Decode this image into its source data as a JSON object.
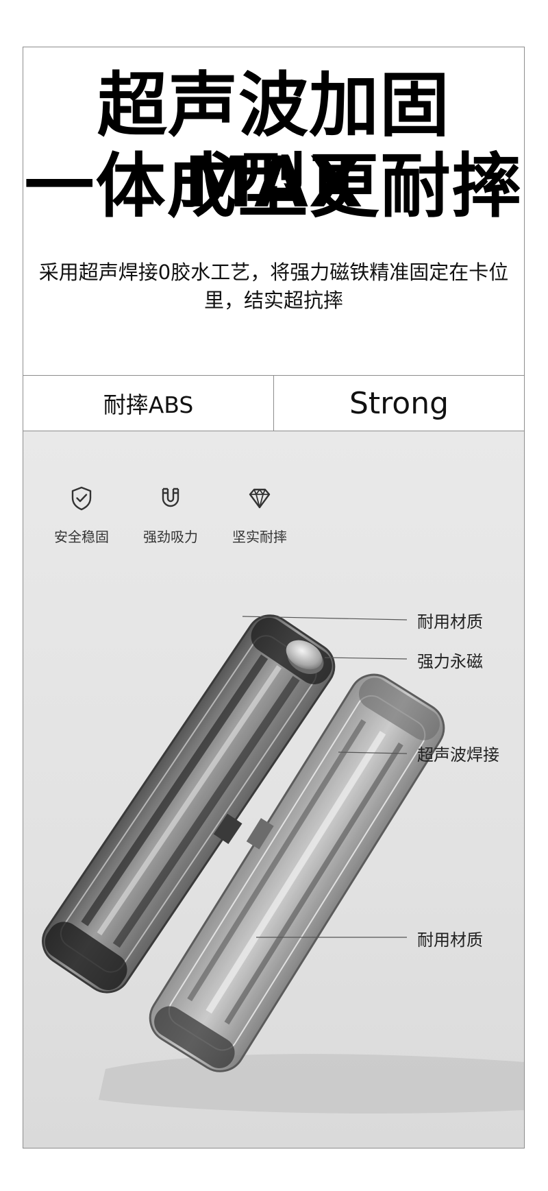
{
  "headline": {
    "line1": "超声波加固MAX",
    "line2": "一体成型更耐摔"
  },
  "description": "采用超声焊接0胶水工艺，将强力磁铁精准固定在卡位里，结实超抗摔",
  "compare": {
    "left": "耐摔ABS",
    "right": "Strong"
  },
  "features": [
    {
      "icon": "shield-check-icon",
      "label": "安全稳固"
    },
    {
      "icon": "magnet-icon",
      "label": "强劲吸力"
    },
    {
      "icon": "diamond-icon",
      "label": "坚实耐摔"
    }
  ],
  "callouts": {
    "material_top": "耐用材质",
    "magnet": "强力永磁",
    "welding": "超声波焊接",
    "material_bottom": "耐用材质"
  },
  "colors": {
    "background": "#ffffff",
    "photo_bg": "#e4e4e4",
    "text": "#111111",
    "border": "#8c8c8c"
  }
}
